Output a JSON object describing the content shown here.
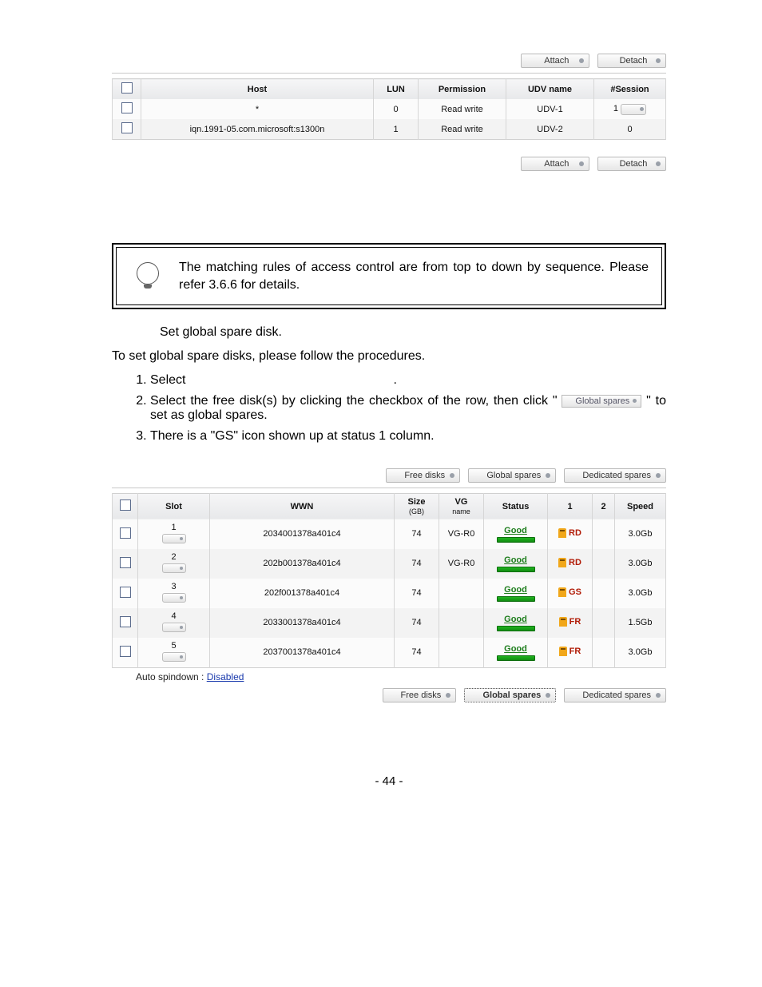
{
  "buttons": {
    "attach": "Attach",
    "detach": "Detach",
    "free_disks": "Free disks",
    "global_spares": "Global spares",
    "dedicated_spares": "Dedicated spares"
  },
  "host_table": {
    "headers": {
      "host": "Host",
      "lun": "LUN",
      "permission": "Permission",
      "udv": "UDV name",
      "session": "#Session"
    },
    "rows": [
      {
        "host": "*",
        "lun": "0",
        "permission": "Read write",
        "udv": "UDV-1",
        "session": "1",
        "session_btn": true
      },
      {
        "host": "iqn.1991-05.com.microsoft:s1300n",
        "lun": "1",
        "permission": "Read write",
        "udv": "UDV-2",
        "session": "0",
        "session_btn": false
      }
    ]
  },
  "tips": "The matching rules of access control are from top to down by sequence. Please refer 3.6.6 for details.",
  "step_heading": "Set global spare disk.",
  "intro": "To set global spare disks, please follow the procedures.",
  "steps": {
    "one": "Select",
    "two_a": "Select the free disk(s) by clicking the checkbox of the row, then click",
    "two_b": "to set as global spares.",
    "three": "There is a \"GS\" icon shown up at status 1 column."
  },
  "disk_table": {
    "headers": {
      "slot": "Slot",
      "wwn": "WWN",
      "size": "Size",
      "size_sub": "(GB)",
      "vg": "VG",
      "vg_sub": "name",
      "status": "Status",
      "c1": "1",
      "c2": "2",
      "speed": "Speed"
    },
    "rows": [
      {
        "slot": "1",
        "wwn": "2034001378a401c4",
        "size": "74",
        "vg": "VG-R0",
        "status": "Good",
        "c1": "RD",
        "speed": "3.0Gb"
      },
      {
        "slot": "2",
        "wwn": "202b001378a401c4",
        "size": "74",
        "vg": "VG-R0",
        "status": "Good",
        "c1": "RD",
        "speed": "3.0Gb"
      },
      {
        "slot": "3",
        "wwn": "202f001378a401c4",
        "size": "74",
        "vg": "",
        "status": "Good",
        "c1": "GS",
        "speed": "3.0Gb"
      },
      {
        "slot": "4",
        "wwn": "2033001378a401c4",
        "size": "74",
        "vg": "",
        "status": "Good",
        "c1": "FR",
        "speed": "1.5Gb"
      },
      {
        "slot": "5",
        "wwn": "2037001378a401c4",
        "size": "74",
        "vg": "",
        "status": "Good",
        "c1": "FR",
        "speed": "3.0Gb"
      }
    ]
  },
  "spindown": {
    "label": "Auto spindown :",
    "value": "Disabled"
  },
  "page_number": "- 44 -"
}
